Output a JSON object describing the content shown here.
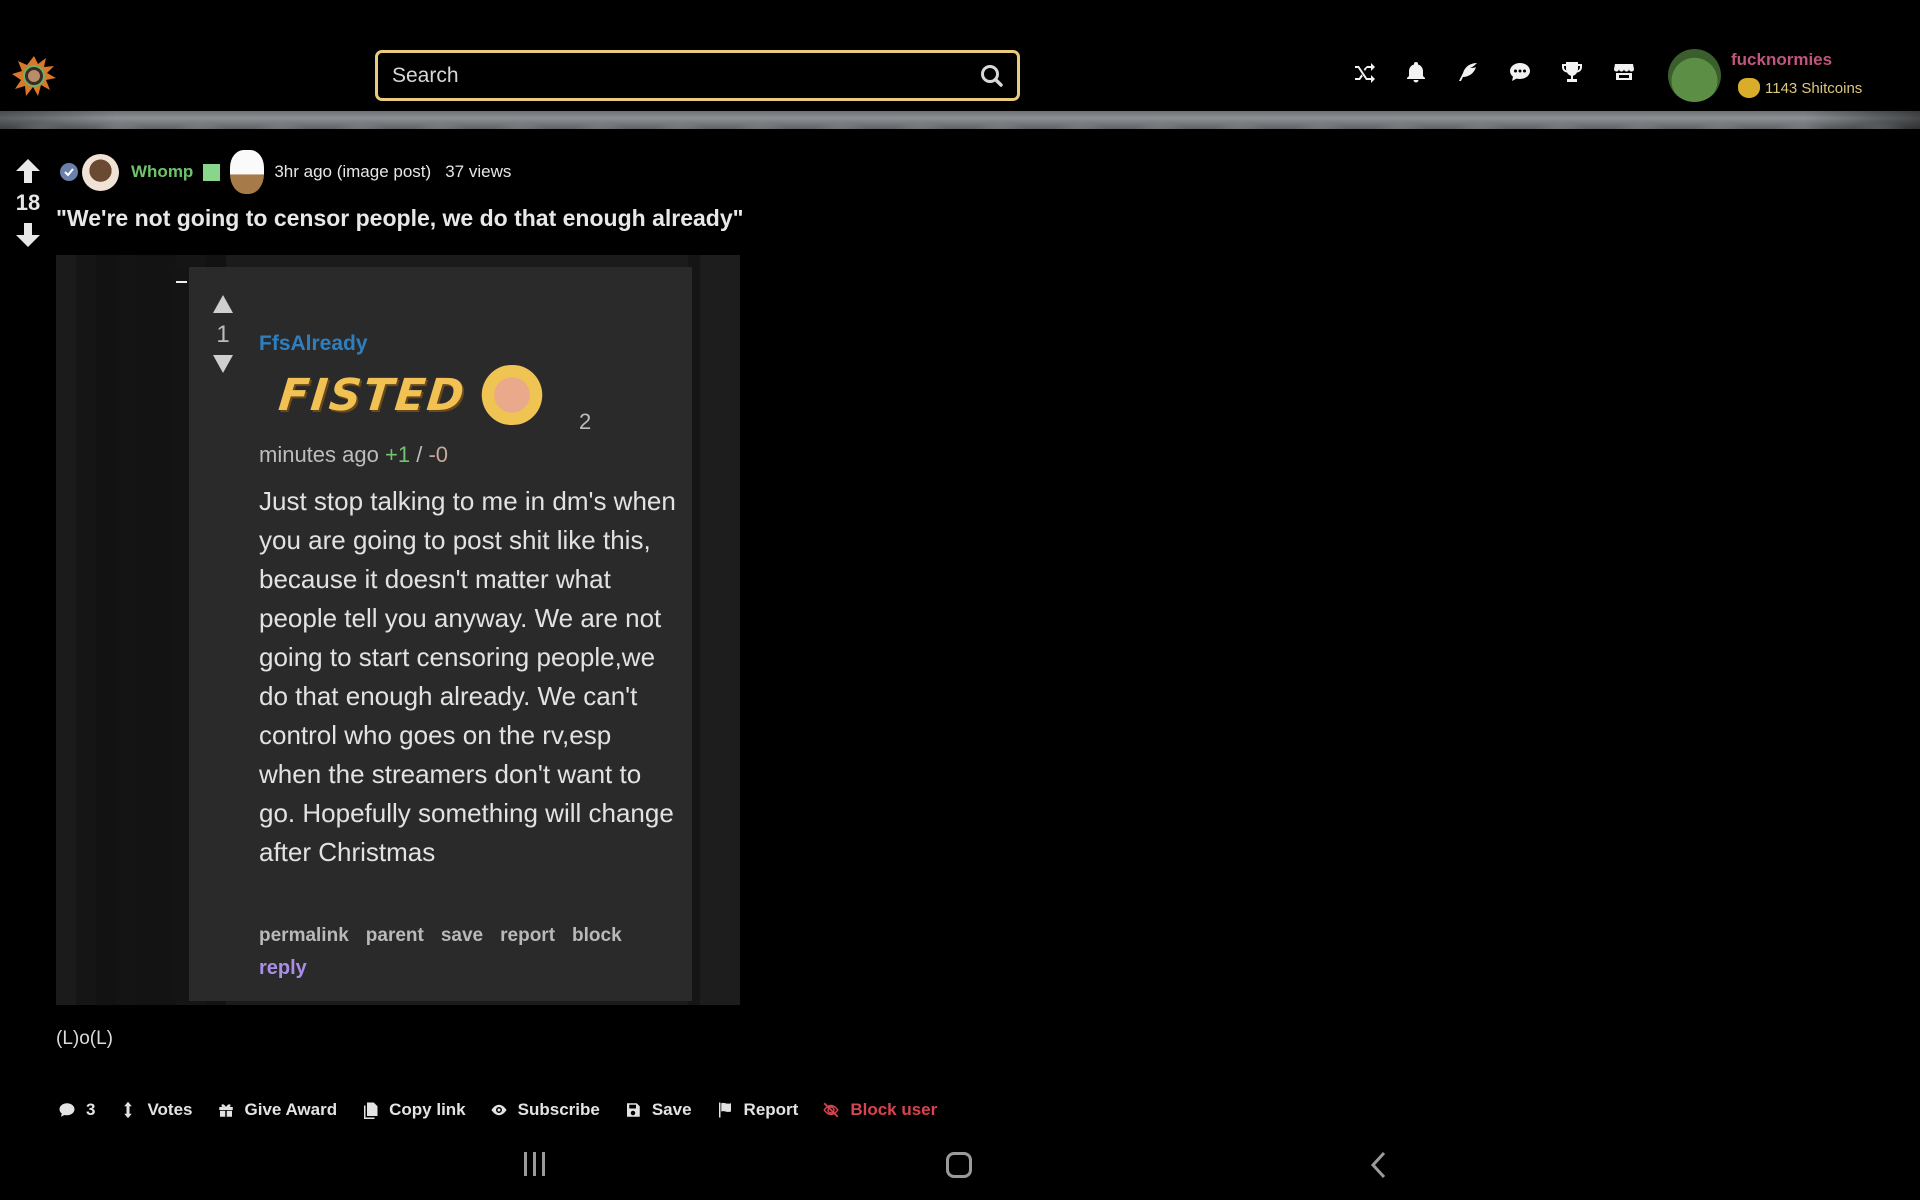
{
  "header": {
    "logo_alt": "site-logo",
    "search": {
      "placeholder": "Search",
      "value": ""
    },
    "nav_icons": [
      "shuffle-icon",
      "bell-icon",
      "feather-icon",
      "chat-icon",
      "trophy-icon",
      "shop-icon"
    ],
    "user": {
      "name": "fucknormies",
      "coins_label": "1143 Shitcoins"
    }
  },
  "post": {
    "score": "18",
    "author": "Whomp",
    "time": "3hr ago (image post)",
    "views": "37 views",
    "title": "\"We're not going to censor people, we do that enough already\"",
    "caption": "(L)o(L)",
    "embedded_comment": {
      "score": "1",
      "author": "FfsAlready",
      "badge_text": "FISTED",
      "badge_count": "2",
      "time": "minutes ago",
      "upvotes": "+1",
      "separator": "/",
      "downvotes": "-0",
      "body": "Just stop talking to me in dm's when you are going to post shit like this, because it doesn't matter what people tell you anyway. We are not going to start censoring people,we do that enough already. We can't control who goes on the rv,esp when the streamers don't want to go. Hopefully something will change after Christmas",
      "actions": [
        "permalink",
        "parent",
        "save",
        "report",
        "block"
      ],
      "reply_label": "reply"
    },
    "actions": {
      "comments_count": "3",
      "votes": "Votes",
      "give_award": "Give Award",
      "copy_link": "Copy link",
      "subscribe": "Subscribe",
      "save": "Save",
      "report": "Report",
      "block_user": "Block user"
    }
  },
  "colors": {
    "search_border": "#e8cb7d",
    "username_accent": "#c2547d",
    "coins": "#dcc77c",
    "author_green": "#6fc36d",
    "comment_author_blue": "#2f7fbf",
    "reply_purple": "#a88ee6",
    "danger_red": "#d6444f"
  },
  "system_nav": [
    "recent-apps",
    "home",
    "back"
  ]
}
